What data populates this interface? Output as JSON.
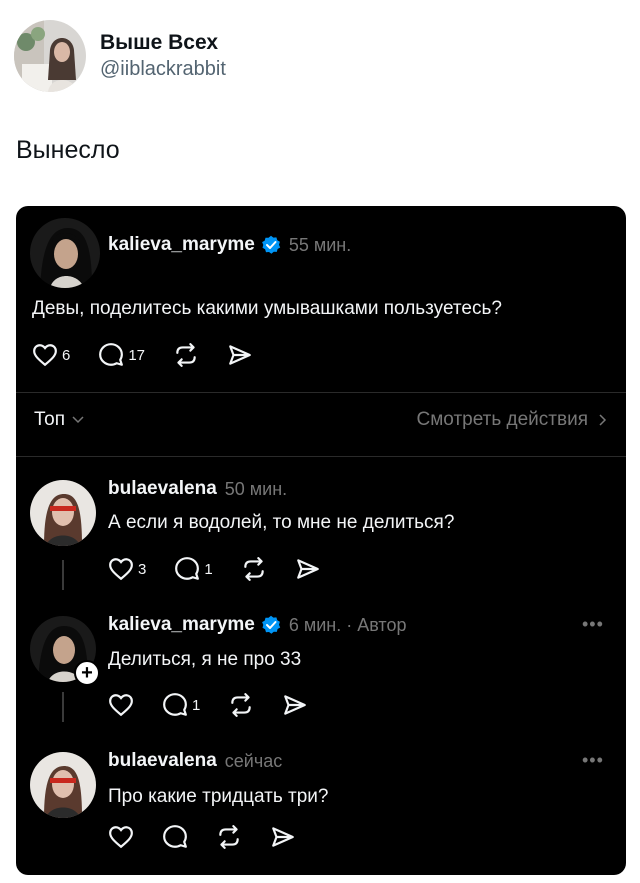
{
  "tweet": {
    "display_name": "Выше Всех",
    "handle": "@iiblackrabbit",
    "text": "Вынесло"
  },
  "post": {
    "username": "kalieva_maryme",
    "time": "55 мин.",
    "text": "Девы, поделитесь какими умывашками пользуетесь?",
    "likes": "6",
    "replies": "17"
  },
  "sort": {
    "label": "Топ",
    "view_actions": "Смотреть действия"
  },
  "replies": [
    {
      "username": "bulaevalena",
      "time": "50 мин.",
      "text": "А если я водолей, то мне не делиться?",
      "likes": "3",
      "replies": "1"
    },
    {
      "username": "kalieva_maryme",
      "time": "6 мин. · Автор",
      "text": "Делиться, я не про 33",
      "likes": "",
      "replies": "1"
    },
    {
      "username": "bulaevalena",
      "time": "сейчас",
      "text": "Про какие тридцать три?",
      "likes": "",
      "replies": ""
    }
  ],
  "colors": {
    "card_bg": "#000000",
    "verified": "#0095f6",
    "muted": "#777777"
  }
}
